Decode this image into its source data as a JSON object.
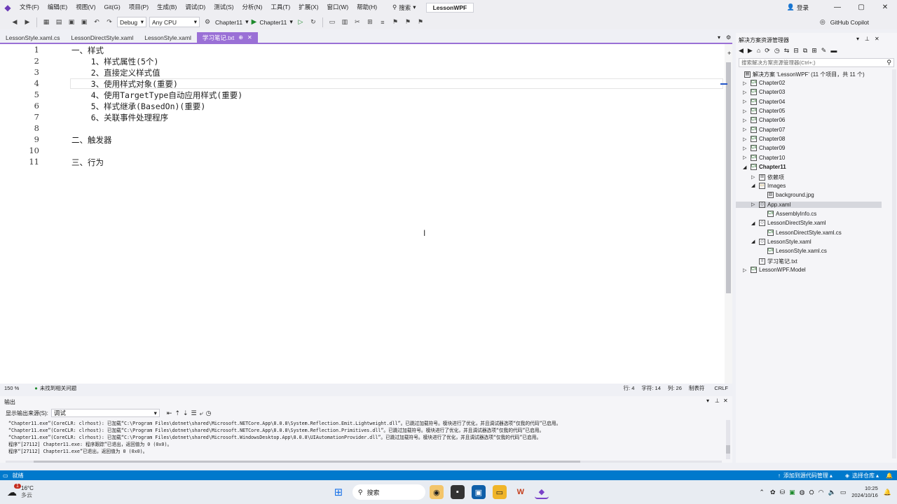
{
  "menubar": {
    "items": [
      "文件(F)",
      "编辑(E)",
      "视图(V)",
      "Git(G)",
      "项目(P)",
      "生成(B)",
      "调试(D)",
      "测试(S)",
      "分析(N)",
      "工具(T)",
      "扩展(X)",
      "窗口(W)",
      "帮助(H)"
    ],
    "search_label": "搜索",
    "solution_name": "LessonWPF",
    "login_label": "登录"
  },
  "toolbar": {
    "config": "Debug",
    "platform": "Any CPU",
    "startup_project": "Chapter11",
    "run_target": "Chapter11",
    "copilot_label": "GitHub Copilot"
  },
  "tabs": [
    {
      "label": "LessonStyle.xaml.cs",
      "active": false
    },
    {
      "label": "LessonDirectStyle.xaml",
      "active": false
    },
    {
      "label": "LessonStyle.xaml",
      "active": false
    },
    {
      "label": "学习笔记.txt",
      "active": true
    }
  ],
  "editor": {
    "lines": [
      {
        "num": "1",
        "text": "一、样式"
      },
      {
        "num": "2",
        "text": "    1、样式属性(5个)"
      },
      {
        "num": "3",
        "text": "    2、直接定义样式值"
      },
      {
        "num": "4",
        "text": "    3、使用样式对象(重要)"
      },
      {
        "num": "5",
        "text": "    4、使用TargetType自动应用样式(重要)"
      },
      {
        "num": "6",
        "text": "    5、样式继承(BasedOn)(重要)"
      },
      {
        "num": "7",
        "text": "    6、关联事件处理程序"
      },
      {
        "num": "8",
        "text": ""
      },
      {
        "num": "9",
        "text": "二、触发器"
      },
      {
        "num": "10",
        "text": ""
      },
      {
        "num": "11",
        "text": "三、行为"
      }
    ],
    "zoom": "150 %",
    "issues": "未找到相关问题",
    "row": "行: 4",
    "char": "字符: 14",
    "col": "列: 26",
    "tab_mode": "制表符",
    "eol": "CRLF"
  },
  "solution_explorer": {
    "title": "解决方案资源管理器",
    "search_placeholder": "搜索解决方案资源管理器(Ctrl+;)",
    "root": "解决方案 'LessonWPF' (11 个项目，共 11 个)",
    "items": [
      {
        "label": "Chapter02",
        "kind": "project"
      },
      {
        "label": "Chapter03",
        "kind": "project"
      },
      {
        "label": "Chapter04",
        "kind": "project"
      },
      {
        "label": "Chapter05",
        "kind": "project"
      },
      {
        "label": "Chapter06",
        "kind": "project"
      },
      {
        "label": "Chapter07",
        "kind": "project"
      },
      {
        "label": "Chapter08",
        "kind": "project"
      },
      {
        "label": "Chapter09",
        "kind": "project"
      },
      {
        "label": "Chapter10",
        "kind": "project"
      },
      {
        "label": "Chapter11",
        "kind": "project-open"
      },
      {
        "label": "依赖项",
        "kind": "deps"
      },
      {
        "label": "Images",
        "kind": "folder"
      },
      {
        "label": "background.jpg",
        "kind": "image"
      },
      {
        "label": "App.xaml",
        "kind": "xaml"
      },
      {
        "label": "AssemblyInfo.cs",
        "kind": "cs"
      },
      {
        "label": "LessonDirectStyle.xaml",
        "kind": "xaml"
      },
      {
        "label": "LessonDirectStyle.xaml.cs",
        "kind": "cs"
      },
      {
        "label": "LessonStyle.xaml",
        "kind": "xaml"
      },
      {
        "label": "LessonStyle.xaml.cs",
        "kind": "cs"
      },
      {
        "label": "学习笔记.txt",
        "kind": "txt"
      },
      {
        "label": "LessonWPF.Model",
        "kind": "project"
      }
    ]
  },
  "output": {
    "title": "输出",
    "source_label": "显示输出来源(S):",
    "source_value": "调试",
    "lines": [
      "“Chapter11.exe”(CoreCLR: clrhost): 已加载“C:\\Program Files\\dotnet\\shared\\Microsoft.NETCore.App\\8.0.8\\System.Reflection.Emit.Lightweight.dll”。已跳过加载符号。模块进行了优化，并且调试器选项“仅我的代码”已启用。",
      "“Chapter11.exe”(CoreCLR: clrhost): 已加载“C:\\Program Files\\dotnet\\shared\\Microsoft.NETCore.App\\8.0.8\\System.Reflection.Primitives.dll”。已跳过加载符号。模块进行了优化，并且调试器选项“仅我的代码”已启用。",
      "“Chapter11.exe”(CoreCLR: clrhost): 已加载“C:\\Program Files\\dotnet\\shared\\Microsoft.WindowsDesktop.App\\8.0.8\\UIAutomationProvider.dll”。已跳过加载符号。模块进行了优化，并且调试器选项“仅我的代码”已启用。",
      "程序“[27112] Chapter11.exe: 程序跟踪”已退出，返回值为 0 (0x0)。",
      "程序“[27112] Chapter11.exe”已退出，返回值为 0 (0x0)。"
    ]
  },
  "statusbar": {
    "ready": "就绪",
    "add_source": "添加到源代码管理",
    "select_repo": "选择仓库"
  },
  "taskbar": {
    "temp": "16°C",
    "weather": "多云",
    "search_label": "搜索",
    "time": "10:25",
    "date": "2024/10/16",
    "badge": "1"
  }
}
